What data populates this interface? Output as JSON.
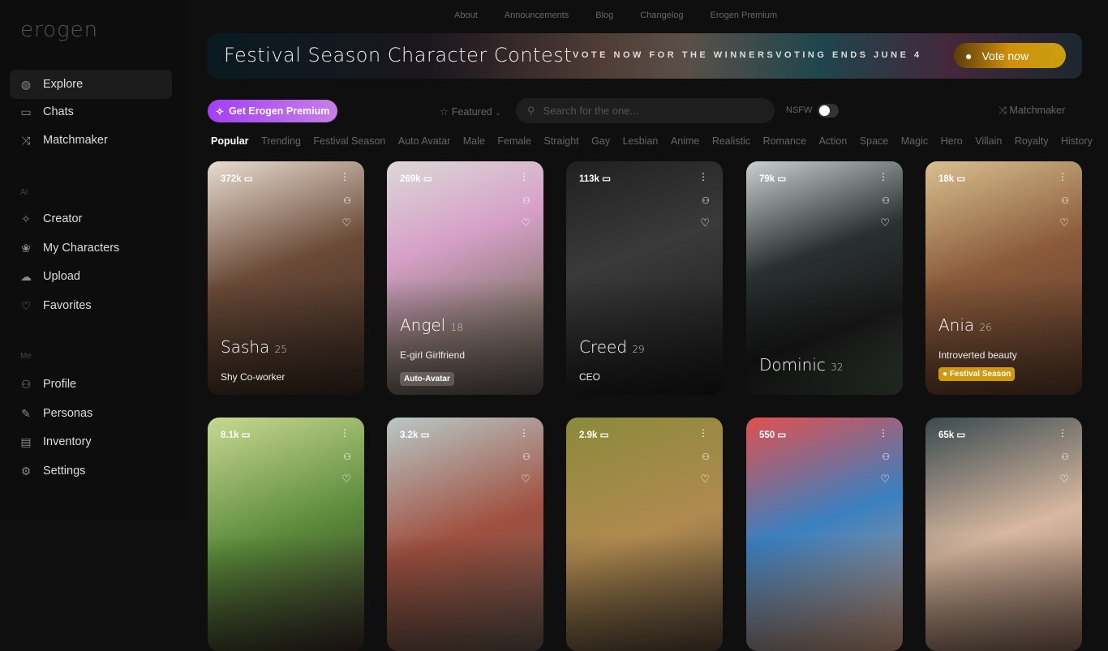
{
  "app": {
    "logo": "erogen"
  },
  "sidebar": {
    "main": [
      {
        "label": "Explore",
        "icon": "globe-icon"
      },
      {
        "label": "Chats",
        "icon": "chat-icon"
      },
      {
        "label": "Matchmaker",
        "icon": "shuffle-icon"
      }
    ],
    "ai_label": "AI",
    "ai": [
      {
        "label": "Creator",
        "icon": "sparkle-icon"
      },
      {
        "label": "My Characters",
        "icon": "circles-icon"
      },
      {
        "label": "Upload",
        "icon": "cloud-upload-icon"
      },
      {
        "label": "Favorites",
        "icon": "heart-icon"
      }
    ],
    "me_label": "Me",
    "me": [
      {
        "label": "Profile",
        "icon": "user-icon"
      },
      {
        "label": "Personas",
        "icon": "user-edit-icon"
      },
      {
        "label": "Inventory",
        "icon": "archive-icon"
      },
      {
        "label": "Settings",
        "icon": "gear-icon"
      }
    ]
  },
  "topnav": [
    "About",
    "Announcements",
    "Blog",
    "Changelog",
    "Erogen Premium"
  ],
  "banner": {
    "title": "Festival Season Character Contest",
    "subtitle": "VOTE NOW FOR THE WINNERSVOTING ENDS JUNE 4",
    "button": "Vote now"
  },
  "toolbar": {
    "premium": "Get Erogen Premium",
    "featured": "Featured",
    "search_placeholder": "Search for the one...",
    "nsfw": "NSFW",
    "nsfw_on": false,
    "matchmaker": "Matchmaker"
  },
  "tags": [
    "Popular",
    "Trending",
    "Festival Season",
    "Auto Avatar",
    "Male",
    "Female",
    "Straight",
    "Gay",
    "Lesbian",
    "Anime",
    "Realistic",
    "Romance",
    "Action",
    "Space",
    "Magic",
    "Hero",
    "Villain",
    "Royalty",
    "History"
  ],
  "cards": [
    {
      "count": "372k",
      "name": "Sasha",
      "age": "25",
      "desc": "Shy Co-worker",
      "badge": ""
    },
    {
      "count": "269k",
      "name": "Angel",
      "age": "18",
      "desc": "E-girl Girlfriend",
      "badge": "Auto-Avatar"
    },
    {
      "count": "113k",
      "name": "Creed",
      "age": "29",
      "desc": "CEO",
      "badge": ""
    },
    {
      "count": "79k",
      "name": "Dominic",
      "age": "32",
      "desc": "",
      "badge": ""
    },
    {
      "count": "18k",
      "name": "Ania",
      "age": "26",
      "desc": "Introverted beauty",
      "badge": "Festival Season"
    },
    {
      "count": "8.1k"
    },
    {
      "count": "3.2k"
    },
    {
      "count": "2.9k"
    },
    {
      "count": "550"
    },
    {
      "count": "65k"
    }
  ]
}
